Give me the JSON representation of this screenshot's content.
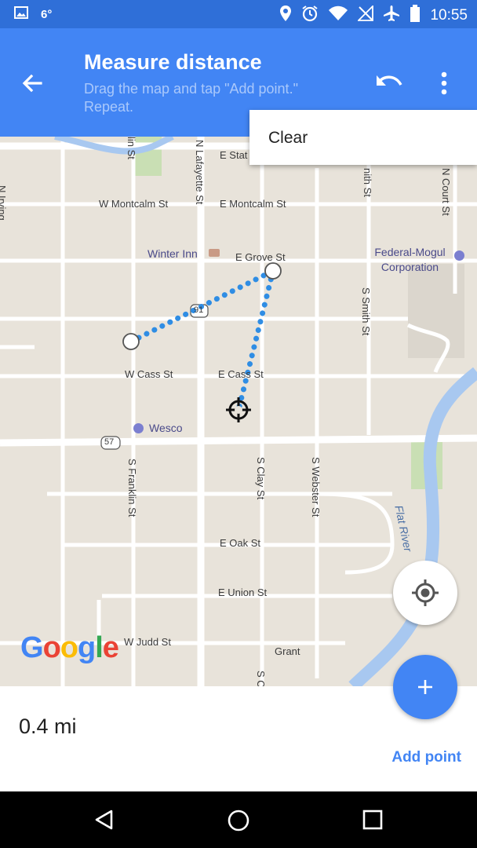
{
  "status_bar": {
    "temperature": "6°",
    "time": "10:55",
    "icons": [
      "image-icon",
      "location-icon",
      "alarm-icon",
      "wifi-icon",
      "no-signal-icon",
      "airplane-icon",
      "battery-icon"
    ]
  },
  "app_bar": {
    "title": "Measure distance",
    "subtitle": "Drag the map and tap \"Add point.\" Repeat.",
    "icons": [
      "back-arrow-icon",
      "undo-icon",
      "more-vert-icon"
    ]
  },
  "menu": {
    "items": [
      "Clear"
    ]
  },
  "map": {
    "streets": {
      "n_lin": "lin St",
      "e_stat": "E Stat",
      "n_lafayette": "N Lafayette St",
      "w_montcalm": "W Montcalm St",
      "e_montcalm": "E Montcalm St",
      "e_grove": "E Grove St",
      "w_cass": "W Cass St",
      "e_cass": "E Cass St",
      "s_smith": "S Smith St",
      "n_court": "N Court St",
      "nith": "nith St",
      "s_franklin": "S Franklin St",
      "s_clay": "S Clay St",
      "s_webster": "S Webster St",
      "e_oak": "E Oak St",
      "e_union": "E Union St",
      "w_judd": "W Judd St",
      "grant": "Grant",
      "s_c": "S C",
      "n_irving": "N Irving",
      "flat_river": "Flat River",
      "route_91": "91",
      "route_57": "57"
    },
    "pois": {
      "winter_inn": "Winter Inn",
      "federal_mogul": "Federal-Mogul Corporation",
      "wesco": "Wesco"
    },
    "logo": "Google",
    "colors": {
      "path": "#2f8de4",
      "water": "#a8c8f0",
      "park": "#c9dfb4"
    }
  },
  "controls": {
    "locate_icon": "my-location-icon",
    "add_icon": "plus-icon"
  },
  "bottom_panel": {
    "distance": "0.4 mi",
    "add_point_label": "Add point"
  },
  "nav_bar": {
    "icons": [
      "back-triangle-icon",
      "home-circle-icon",
      "recents-square-icon"
    ]
  }
}
